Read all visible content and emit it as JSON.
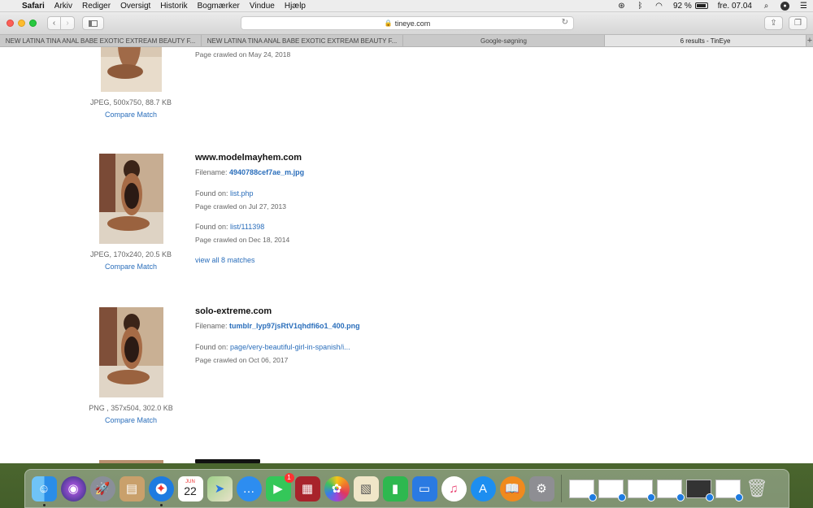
{
  "menubar": {
    "app_name": "Safari",
    "menus": [
      "Arkiv",
      "Rediger",
      "Oversigt",
      "Historik",
      "Bogmærker",
      "Vindue",
      "Hjælp"
    ],
    "battery_text": "92 %",
    "clock": "fre. 07.04"
  },
  "toolbar": {
    "url": "tineye.com"
  },
  "tabs": [
    {
      "title": "NEW LATINA TINA ANAL BABE EXOTIC EXTREAM BEAUTY F..."
    },
    {
      "title": "NEW LATINA TINA ANAL BABE EXOTIC EXTREAM BEAUTY F..."
    },
    {
      "title": "Google-søgning"
    },
    {
      "title": "6 results - TinEye"
    }
  ],
  "results": [
    {
      "img_meta": "JPEG, 500x750, 88.7 KB",
      "compare": "Compare Match",
      "crawl": "Page crawled on May 24, 2018"
    },
    {
      "domain": "www.modelmayhem.com",
      "filename_label": "Filename:",
      "filename": "4940788cef7ae_m.jpg",
      "found": [
        {
          "label": "Found on:",
          "link": "list.php",
          "crawl": "Page crawled on Jul 27, 2013"
        },
        {
          "label": "Found on:",
          "link": "list/111398",
          "crawl": "Page crawled on Dec 18, 2014"
        }
      ],
      "view_all": "view all 8 matches",
      "img_meta": "JPEG, 170x240, 20.5 KB",
      "compare": "Compare Match"
    },
    {
      "domain": "solo-extreme.com",
      "filename_label": "Filename:",
      "filename": "tumblr_lyp97jsRtV1qhdfi6o1_400.png",
      "found": [
        {
          "label": "Found on:",
          "link": "page/very-beautiful-girl-in-spanish/i...",
          "crawl": "Page crawled on Oct 06, 2017"
        }
      ],
      "img_meta": "PNG , 357x504, 302.0 KB",
      "compare": "Compare Match"
    }
  ],
  "dock": {
    "calendar_month": "JUN",
    "calendar_day": "22",
    "facetime_badge": "1"
  }
}
